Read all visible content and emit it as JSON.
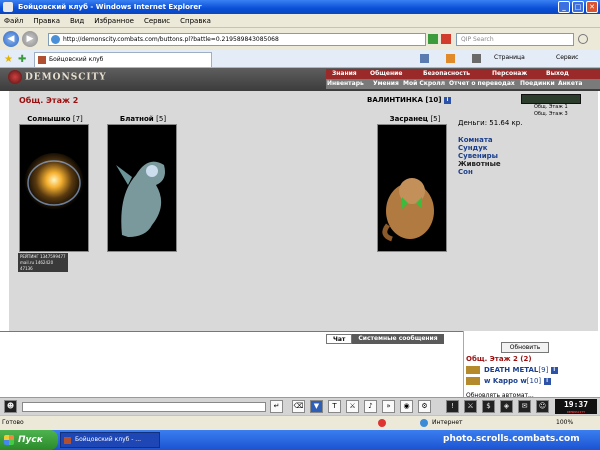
{
  "window": {
    "title": "Бойцовский клуб - Windows Internet Explorer",
    "minimize": "_",
    "maximize": "□",
    "close": "✕"
  },
  "menu": [
    "Файл",
    "Правка",
    "Вид",
    "Избранное",
    "Сервис",
    "Справка"
  ],
  "nav": {
    "url": "http://demonscity.combats.com/buttons.pl?battle=0.219589843085068",
    "search_placeholder": "QIP Search"
  },
  "tab": {
    "title": "Бойцовский клуб",
    "page_label": "Страница",
    "tools_label": "Сервис"
  },
  "game_header": {
    "logo": "DEMONSCITY",
    "nav_row1": [
      "Знания",
      "Общение",
      "Безопасность",
      "Персонаж",
      "Выход"
    ],
    "nav_row2": [
      "Инвентарь",
      "Умения",
      "Мой Скролл",
      "Отчет о переводах",
      "Поединки",
      "Анкета"
    ]
  },
  "location": {
    "title": "Общ. Этаж 2",
    "player_name": "ВАЛИНТИНКА",
    "player_level": "[10]",
    "money": "Деньги: 51.64 кр.",
    "exits": [
      "Общ. Этаж 1",
      "Общ. Этаж 3"
    ],
    "links": [
      "Комната",
      "Сундук",
      "Сувениры",
      "Животные",
      "Сон"
    ]
  },
  "npcs": [
    {
      "name": "Солнышко",
      "level": "[7]"
    },
    {
      "name": "Блатной",
      "level": "[5]"
    },
    {
      "name": "Засранец",
      "level": "[5]"
    }
  ],
  "rating": {
    "line1": "РЕЙТИНГ 1347599477",
    "line2": "mail.ru 1462420",
    "line3": "47136"
  },
  "chat": {
    "tab_chat": "Чат",
    "tab_system": "Системные сообщения"
  },
  "sidebar": {
    "refresh": "Обновить",
    "title": "Общ. Этаж 2 (2)",
    "users": [
      {
        "name": "DEATH METAL",
        "level": "[9]"
      },
      {
        "name": "w Kappo w",
        "level": "[10]"
      }
    ],
    "auto_update": "Обновлять автомат..."
  },
  "clock": {
    "time": "19:37",
    "sub": "DEMONSCITY"
  },
  "statusbar": {
    "status": "Готово",
    "zone": "Интернет",
    "zoom": "100%"
  },
  "taskbar": {
    "start": "Пуск",
    "item": "Бойцовский клуб - ...",
    "watermark": "photo.scrolls.combats.com"
  }
}
